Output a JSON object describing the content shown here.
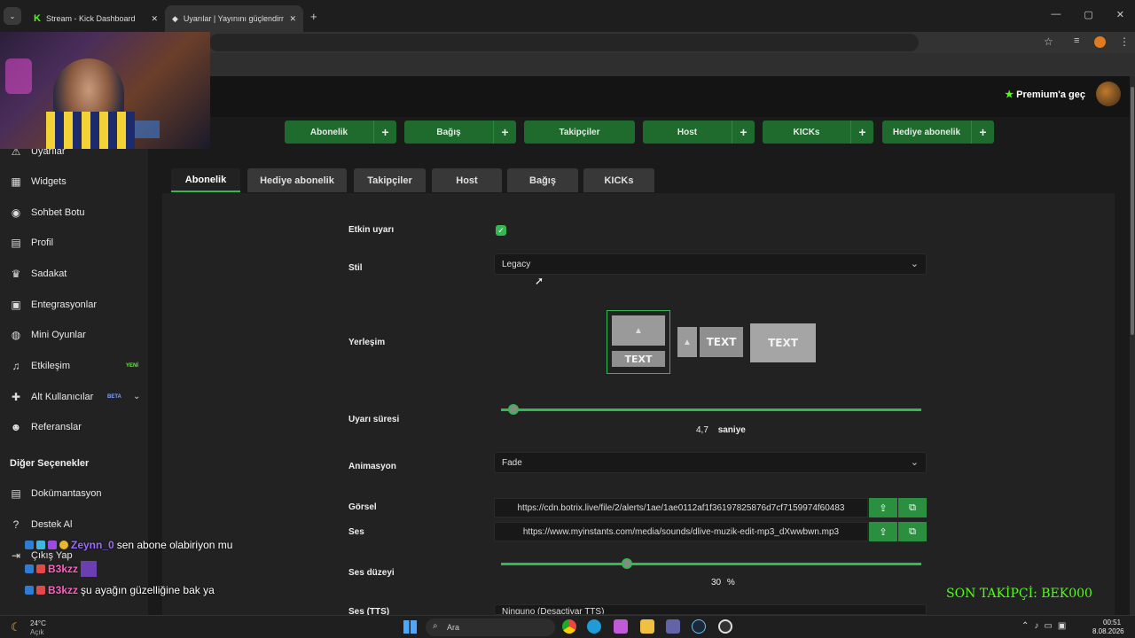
{
  "browser": {
    "tabs": [
      {
        "title": "Stream - Kick Dashboard"
      },
      {
        "title": "Uyarılar | Yayınını güçlendirmek"
      }
    ],
    "new_tab": "+",
    "win": {
      "min": "—",
      "max": "▢",
      "close": "✕"
    }
  },
  "header": {
    "premium": "Premium'a geç"
  },
  "quick_buttons": [
    "Abonelik",
    "Bağış",
    "Takipçiler",
    "Host",
    "KICKs",
    "Hediye abonelik"
  ],
  "sidebar": {
    "items": [
      {
        "label": "Uyarılar",
        "icon": "warning-icon"
      },
      {
        "label": "Widgets",
        "icon": "grid-icon"
      },
      {
        "label": "Sohbet Botu",
        "icon": "bot-icon"
      },
      {
        "label": "Profil",
        "icon": "id-card-icon"
      },
      {
        "label": "Sadakat",
        "icon": "trophy-icon"
      },
      {
        "label": "Entegrasyonlar",
        "icon": "plug-icon"
      },
      {
        "label": "Mini Oyunlar",
        "icon": "gamepad-icon"
      },
      {
        "label": "Etkileşim",
        "icon": "music-icon",
        "badge": "YENİ"
      },
      {
        "label": "Alt Kullanıcılar",
        "icon": "users-icon",
        "badge": "BETA"
      },
      {
        "label": "Referanslar",
        "icon": "people-icon"
      }
    ],
    "section": "Diğer Seçenekler",
    "other": [
      {
        "label": "Dokümantasyon",
        "icon": "doc-icon"
      },
      {
        "label": "Destek Al",
        "icon": "help-icon"
      },
      {
        "label": "Çıkış Yap",
        "icon": "logout-icon"
      }
    ]
  },
  "tabs": [
    "Abonelik",
    "Hediye abonelik",
    "Takipçiler",
    "Host",
    "Bağış",
    "KICKs"
  ],
  "form": {
    "enabled_label": "Etkin uyarı",
    "style_label": "Stil",
    "style_value": "Legacy",
    "layout_label": "Yerleşim",
    "layout_text": "TEXT",
    "duration_label": "Uyarı süresi",
    "duration_value": "4,7",
    "duration_unit": "saniye",
    "duration_fraction": 0.03,
    "animation_label": "Animasyon",
    "animation_value": "Fade",
    "image_label": "Görsel",
    "image_url": "https://cdn.botrix.live/file/2/alerts/1ae/1ae0112af1f36197825876d7cf7159974f60483",
    "sound_label": "Ses",
    "sound_url": "https://www.myinstants.com/media/sounds/dlive-muzik-edit-mp3_dXwwbwn.mp3",
    "volume_label": "Ses düzeyi",
    "volume_value": "30",
    "volume_unit": "%",
    "volume_fraction": 0.3,
    "tts_label": "Ses (TTS)",
    "tts_value": "Ninguno (Desactivar TTS)"
  },
  "chat": [
    {
      "user": "Zeynn_0",
      "text": "sen abone olabiriyon mu"
    },
    {
      "user": "B3kzz",
      "text": ""
    },
    {
      "user": "B3kzz",
      "text": "şu ayağın güzelliğine bak ya"
    }
  ],
  "overlay": {
    "last_follower": "SON TAKİPÇİ: BEK000"
  },
  "taskbar": {
    "temp": "24°C",
    "weather": "Açık",
    "search": "Ara",
    "time": "00:51",
    "date": "8.08.2026"
  }
}
